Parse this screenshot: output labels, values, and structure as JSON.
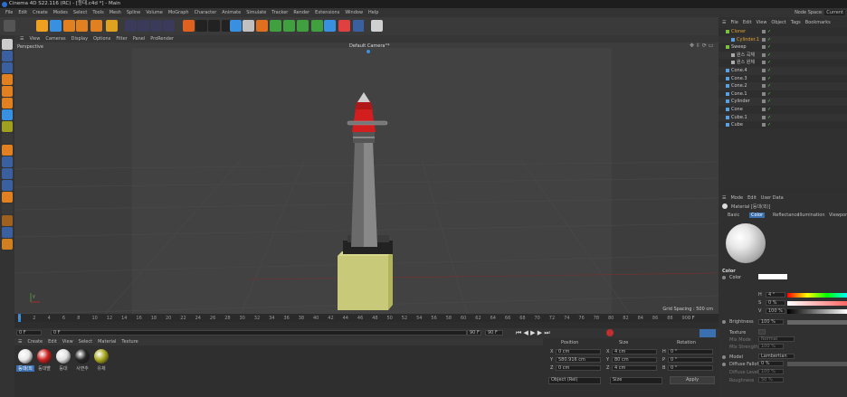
{
  "title": "Cinema 4D S22.116 (RC) - [등대.c4d *] - Main",
  "menu": [
    "File",
    "Edit",
    "Create",
    "Modes",
    "Select",
    "Tools",
    "Mesh",
    "Spline",
    "Volume",
    "MoGraph",
    "Character",
    "Animate",
    "Simulate",
    "Tracker",
    "Render",
    "Extensions",
    "Window",
    "Help"
  ],
  "node_space": "Node Space:",
  "node_space_value": "Current",
  "viewport": {
    "menu": [
      "View",
      "Cameras",
      "Display",
      "Options",
      "Filter",
      "Panel",
      "ProRender"
    ],
    "label": "Perspective",
    "camera": "Default Camera",
    "grid_spacing": "Grid Spacing : 500 cm"
  },
  "timeline": {
    "ticks": [
      "0",
      "2",
      "4",
      "6",
      "8",
      "10",
      "12",
      "14",
      "16",
      "18",
      "20",
      "22",
      "24",
      "26",
      "28",
      "30",
      "32",
      "34",
      "36",
      "38",
      "40",
      "42",
      "44",
      "46",
      "48",
      "50",
      "52",
      "54",
      "56",
      "58",
      "60",
      "62",
      "64",
      "66",
      "68",
      "70",
      "72",
      "74",
      "76",
      "78",
      "80",
      "82",
      "84",
      "86",
      "88",
      "90"
    ],
    "end_frame": "0 F"
  },
  "transport": {
    "current": "0 F",
    "start": "0 F",
    "end": "90 F",
    "end2": "90 F"
  },
  "material_manager": {
    "menu": [
      "Create",
      "Edit",
      "View",
      "Select",
      "Material",
      "Texture"
    ],
    "materials": [
      {
        "name": "등대(외",
        "color": "#e8e8e8",
        "selected": true
      },
      {
        "name": "등대빨",
        "color": "#cc2020"
      },
      {
        "name": "등대",
        "color": "#e0e0e0"
      },
      {
        "name": "사면추",
        "color": "#262626"
      },
      {
        "name": "유채",
        "color": "#a8a820"
      }
    ]
  },
  "coordinates": {
    "headers": [
      "Position",
      "Size",
      "Rotation"
    ],
    "rows": [
      {
        "axis": "X",
        "pos": "0 cm",
        "size_axis": "X",
        "size": "4 cm",
        "rot_axis": "H",
        "rot": "0 °"
      },
      {
        "axis": "Y",
        "pos": "580.916 cm",
        "size_axis": "Y",
        "size": "80 cm",
        "rot_axis": "P",
        "rot": "0 °"
      },
      {
        "axis": "Z",
        "pos": "0 cm",
        "size_axis": "Z",
        "size": "4 cm",
        "rot_axis": "B",
        "rot": "0 °"
      }
    ],
    "mode": "Object (Rel)",
    "size_mode": "Size",
    "apply": "Apply"
  },
  "object_manager": {
    "menu": [
      "File",
      "Edit",
      "View",
      "Object",
      "Tags",
      "Bookmarks"
    ],
    "objects": [
      {
        "name": "Cloner",
        "indent": 0,
        "color": "#e0a030",
        "icon": "#7ac142"
      },
      {
        "name": "Cylinder.1",
        "indent": 1,
        "color": "#e0a030",
        "icon": "#5aa0e0"
      },
      {
        "name": "Sweep",
        "indent": 0,
        "color": "#c8c8c8",
        "icon": "#7ac142"
      },
      {
        "name": "원스 곡체",
        "indent": 1,
        "color": "#c8c8c8",
        "icon": "#aaa"
      },
      {
        "name": "원스 원체",
        "indent": 1,
        "color": "#c8c8c8",
        "icon": "#aaa"
      },
      {
        "name": "Cone.4",
        "indent": 0,
        "color": "#c8c8c8",
        "icon": "#5aa0e0"
      },
      {
        "name": "Cone.3",
        "indent": 0,
        "color": "#c8c8c8",
        "icon": "#5aa0e0"
      },
      {
        "name": "Cone.2",
        "indent": 0,
        "color": "#c8c8c8",
        "icon": "#5aa0e0"
      },
      {
        "name": "Cone.1",
        "indent": 0,
        "color": "#c8c8c8",
        "icon": "#5aa0e0"
      },
      {
        "name": "Cylinder",
        "indent": 0,
        "color": "#c8c8c8",
        "icon": "#5aa0e0"
      },
      {
        "name": "Cone",
        "indent": 0,
        "color": "#c8c8c8",
        "icon": "#5aa0e0"
      },
      {
        "name": "Cube.1",
        "indent": 0,
        "color": "#c8c8c8",
        "icon": "#5aa0e0"
      },
      {
        "name": "Cube",
        "indent": 0,
        "color": "#c8c8c8",
        "icon": "#5aa0e0"
      }
    ]
  },
  "attributes": {
    "menu": [
      "Mode",
      "Edit",
      "User Data"
    ],
    "title": "Material [등대(외)]",
    "tabs": [
      "Basic",
      "Color",
      "Reflectance",
      "Illumination",
      "Viewport"
    ],
    "active_tab": "Color",
    "section": "Color",
    "color_label": "Color",
    "h": "4 °",
    "s": "0 %",
    "v": "100 %",
    "brightness_label": "Brightness",
    "brightness": "100 %",
    "texture_label": "Texture",
    "mix_mode_label": "Mix Mode",
    "mix_mode": "Normal",
    "mix_strength_label": "Mix Strength",
    "mix_strength": "100 %",
    "model_label": "Model",
    "model": "Lambertian",
    "diffuse_falloff_label": "Diffuse Falloff",
    "diffuse_falloff": "0 %",
    "diffuse_level_label": "Diffuse Level",
    "diffuse_level": "100 %",
    "roughness_label": "Roughness",
    "roughness": "50 %"
  }
}
